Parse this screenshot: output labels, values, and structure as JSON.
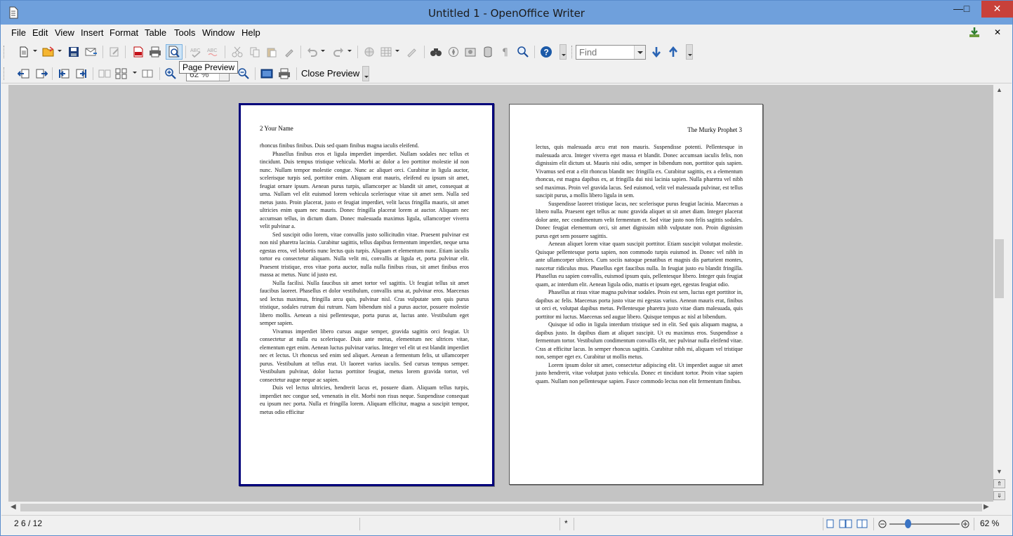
{
  "window": {
    "title": "Untitled 1 - OpenOffice Writer",
    "min_glyph": "—",
    "max_glyph": "□",
    "close_glyph": "✕"
  },
  "menubar": {
    "items": [
      "File",
      "Edit",
      "View",
      "Insert",
      "Format",
      "Table",
      "Tools",
      "Window",
      "Help"
    ],
    "close_doc_glyph": "✕"
  },
  "toolbar": {
    "find_placeholder": "Find",
    "tooltip": "Page Preview"
  },
  "preview_toolbar": {
    "zoom_value": "62 %",
    "close_preview_label": "Close Preview"
  },
  "pages": {
    "left": {
      "header": "2 Your Name",
      "paragraphs": [
        "rhoncus finibus finibus. Duis sed quam finibus magna iaculis eleifend.",
        "Phasellus finibus eros et ligula imperdiet imperdiet. Nullam sodales nec tellus et tincidunt. Duis tempus tristique vehicula. Morbi ac dolor a leo porttitor molestie id non nunc. Nullam tempor molestie congue. Nunc ac aliquet orci. Curabitur in ligula auctor, scelerisque turpis sed, porttitor enim. Aliquam erat mauris, eleifend eu ipsum sit amet, feugiat ornare ipsum. Aenean purus turpis, ullamcorper ac blandit sit amet, consequat at urna. Nullam vel elit euismod lorem vehicula scelerisque vitae sit amet sem. Nulla sed metus justo. Proin placerat, justo et feugiat imperdiet, velit lacus fringilla mauris, sit amet ultricies enim quam nec mauris. Donec fringilla placerat lorem at auctor. Aliquam nec accumsan tellus, in dictum diam. Donec malesuada maximus ligula, ullamcorper viverra velit pulvinar a.",
        "Sed suscipit odio lorem, vitae convallis justo sollicitudin vitae. Praesent pulvinar est non nisl pharetra lacinia. Curabitur sagittis, tellus dapibus fermentum imperdiet, neque urna egestas eros, vel lobortis nunc lectus quis turpis. Aliquam et elementum nunc. Etiam iaculis tortor eu consectetur aliquam. Nulla velit mi, convallis at ligula et, porta pulvinar elit. Praesent tristique, eros vitae porta auctor, nulla nulla finibus risus, sit amet finibus eros massa ac metus. Nunc id justo est.",
        "Nulla facilisi. Nulla faucibus sit amet tortor vel sagittis. Ut feugiat tellus sit amet faucibus laoreet. Phasellus et dolor vestibulum, convallis urna at, pulvinar eros. Maecenas sed lectus maximus, fringilla arcu quis, pulvinar nisl. Cras vulputate sem quis purus tristique, sodales rutrum dui rutrum. Nam bibendum nisl a purus auctor, posuere molestie libero mollis. Aenean a nisi pellentesque, porta purus at, luctus ante. Vestibulum eget semper sapien.",
        "Vivamus imperdiet libero cursus augue semper, gravida sagittis orci feugiat. Ut consectetur at nulla eu scelerisque. Duis ante metus, elementum nec ultrices vitae, elementum eget enim. Aenean luctus pulvinar varius. Integer vel elit ut est blandit imperdiet nec et lectus. Ut rhoncus sed enim sed aliquet. Aenean a fermentum felis, ut ullamcorper purus. Vestibulum at tellus erat. Ut laoreet varius iaculis. Sed cursus tempus semper. Vestibulum pulvinar, dolor luctus porttitor feugiat, metus lorem gravida tortor, vel consectetur augue neque ac sapien.",
        "Duis vel lectus ultricies, hendrerit lacus et, posuere diam. Aliquam tellus turpis, imperdiet nec congue sed, venenatis in elit. Morbi non risus neque. Suspendisse consequat eu ipsum nec porta. Nulla et fringilla lorem. Aliquam efficitur, magna a suscipit tempor, metus odio efficitur"
      ]
    },
    "right": {
      "header": "The Murky Prophet 3",
      "paragraphs": [
        "lectus, quis malesuada arcu erat non mauris. Suspendisse potenti. Pellentesque in malesuada arcu. Integer viverra eget massa et blandit. Donec accumsan iaculis felis, non dignissim elit dictum ut. Mauris nisi odio, semper in bibendum non, porttitor quis sapien. Vivamus sed erat a elit rhoncus blandit nec fringilla ex. Curabitur sagittis, ex a elementum rhoncus, est magna dapibus ex, at fringilla dui nisi lacinia sapien. Nulla pharetra vel nibh sed maximus. Proin vel gravida lacus. Sed euismod, velit vel malesuada pulvinar, est tellus suscipit purus, a mollis libero ligula in sem.",
        "Suspendisse laoreet tristique lacus, nec scelerisque purus feugiat lacinia. Maecenas a libero nulla. Praesent eget tellus ac nunc gravida aliquet ut sit amet diam. Integer placerat dolor ante, nec condimentum velit fermentum et. Sed vitae justo non felis sagittis sodales. Donec feugiat elementum orci, sit amet dignissim nibh vulputate non. Proin dignissim purus eget sem posuere sagittis.",
        "Aenean aliquet lorem vitae quam suscipit porttitor. Etiam suscipit volutpat molestie. Quisque pellentesque porta sapien, non commodo turpis euismod in. Donec vel nibh in ante ullamcorper ultrices. Cum sociis natoque penatibus et magnis dis parturient montes, nascetur ridiculus mus. Phasellus eget faucibus nulla. In feugiat justo eu blandit fringilla. Phasellus eu sapien convallis, euismod ipsum quis, pellentesque libero. Integer quis feugiat quam, ac interdum elit. Aenean ligula odio, mattis et ipsum eget, egestas feugiat odio.",
        "Phasellus at risus vitae magna pulvinar sodales. Proin est sem, luctus eget porttitor in, dapibus ac felis. Maecenas porta justo vitae mi egestas varius. Aenean mauris erat, finibus ut orci et, volutpat dapibus metus. Pellentesque pharetra justo vitae diam malesuada, quis porttitor mi luctus. Maecenas sed augue libero. Quisque tempus ac nisl at bibendum.",
        "Quisque id odio in ligula interdum tristique sed in elit. Sed quis aliquam magna, a dapibus justo. In dapibus diam at aliquet suscipit. Ut eu maximus eros. Suspendisse a fermentum tortor. Vestibulum condimentum convallis elit, nec pulvinar nulla eleifend vitae. Cras at efficitur lacus. In semper rhoncus sagittis. Curabitur nibh mi, aliquam vel tristique non, semper eget ex. Curabitur ut mollis metus.",
        "Lorem ipsum dolor sit amet, consectetur adipiscing elit. Ut imperdiet augue sit amet justo hendrerit, vitae volutpat justo vehicula. Donec et tincidunt tortor. Proin vitae sapien quam. Nullam non pellentesque sapien. Fusce commodo lectus non elit fermentum finibus."
      ]
    }
  },
  "statusbar": {
    "page_indicator": "2 6 / 12",
    "modified_flag": "*",
    "zoom_percent": "62 %"
  }
}
